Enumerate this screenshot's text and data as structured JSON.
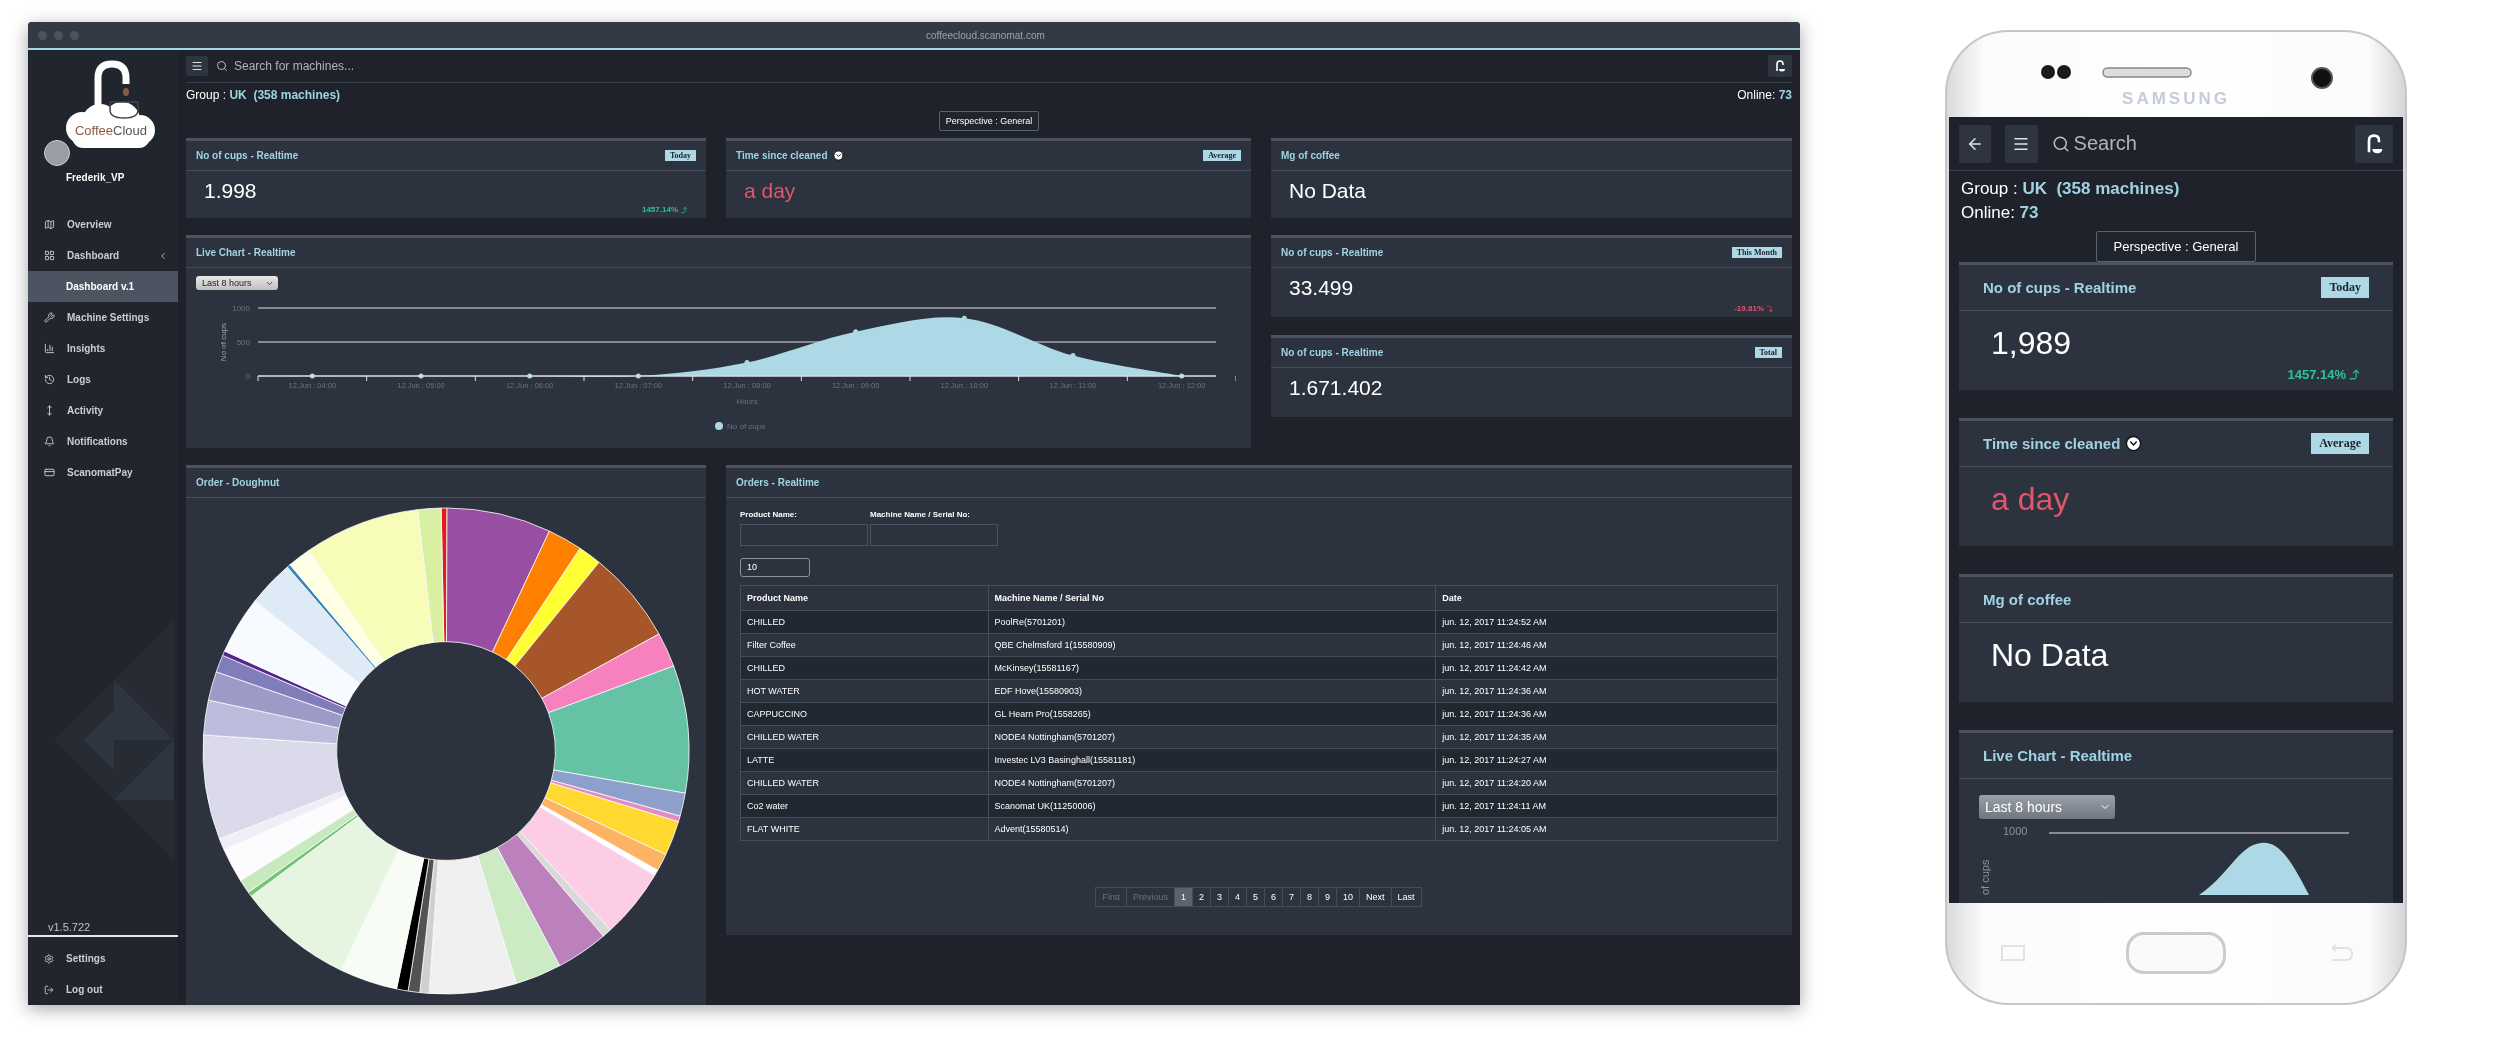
{
  "browser": {
    "url": "coffeecloud.scanomat.com"
  },
  "sidebar": {
    "logo": {
      "part_1": "Coffee",
      "part_2": "Cloud"
    },
    "user": "Frederik_VP",
    "nav": [
      {
        "label": "Overview",
        "selected": false
      },
      {
        "label": "Dashboard",
        "selected": false,
        "children": [
          {
            "label": "Dashboard v.1",
            "selected": true
          }
        ]
      },
      {
        "label": "Machine Settings",
        "selected": false
      },
      {
        "label": "Insights",
        "selected": false
      },
      {
        "label": "Logs",
        "selected": false
      },
      {
        "label": "Activity",
        "selected": false
      },
      {
        "label": "Notifications",
        "selected": false
      },
      {
        "label": "ScanomatPay",
        "selected": false
      }
    ],
    "version": "v1.5.722",
    "footer": [
      {
        "label": "Settings"
      },
      {
        "label": "Log out"
      }
    ]
  },
  "main": {
    "search": {
      "placeholder": "Search for machines..."
    },
    "group": {
      "label": "Group :",
      "name": "UK",
      "machines": "(358 machines)"
    },
    "online": {
      "label": "Online:",
      "value": "73"
    },
    "perspective": "Perspective : General",
    "stat_cards": [
      {
        "title": "No of cups - Realtime",
        "has_dropdown": false,
        "badge": "Today",
        "value": "1.998",
        "alert": false,
        "change": "1457.14%",
        "rising": true
      },
      {
        "title": "Time since cleaned",
        "has_dropdown": true,
        "badge": "Average",
        "value": "a day",
        "alert": true
      },
      {
        "title": "Mg of coffee",
        "has_dropdown": false,
        "value": "No Data",
        "alert": false
      }
    ],
    "live_chart": {
      "title": "Live Chart - Realtime",
      "range": "Last 8 hours",
      "chart_data": {
        "type": "area",
        "xlabel": "Hours",
        "ylabel": "No of cups",
        "categories": [
          "12.Jun : 04:00",
          "12.Jun : 05:00",
          "12.Jun : 06:00",
          "12.Jun : 07:00",
          "12.Jun : 08:00",
          "12.Jun : 09:00",
          "12.Jun : 10:00",
          "12.Jun : 11:00",
          "12.Jun : 12:00"
        ],
        "series": [
          {
            "name": "No of cups",
            "color": "#add8e6",
            "values": [
              0,
              0,
              0,
              0,
              200,
              650,
              850,
              300,
              0
            ]
          }
        ],
        "ylim": [
          0,
          1000
        ],
        "yticks": [
          0,
          500,
          1000
        ]
      }
    },
    "side_cards": [
      {
        "title": "No of cups - Realtime",
        "has_dropdown": false,
        "badge": "This Month",
        "value": "33.499",
        "alert": false,
        "change": "-19.81%",
        "rising": false
      },
      {
        "title": "No of cups - Realtime",
        "has_dropdown": false,
        "badge": "Total",
        "value": "1.671.402",
        "alert": false
      }
    ],
    "doughnut": {
      "title": "Order - Doughnut"
    },
    "orders": {
      "title": "Orders - Realtime",
      "filters": [
        {
          "label": "Product Name:"
        },
        {
          "label": "Machine Name / Serial No:"
        }
      ],
      "page_size": "10",
      "columns": [
        "Product Name",
        "Machine Name / Serial No",
        "Date"
      ],
      "rows": [
        [
          "CHILLED",
          "PoolRe(5701201)",
          "jun. 12, 2017 11:24:52 AM"
        ],
        [
          "Filter Coffee",
          "QBE Chelmsford 1(15580909)",
          "jun. 12, 2017 11:24:46 AM"
        ],
        [
          "CHILLED",
          "McKinsey(15581167)",
          "jun. 12, 2017 11:24:42 AM"
        ],
        [
          "HOT WATER",
          "EDF Hove(15580903)",
          "jun. 12, 2017 11:24:36 AM"
        ],
        [
          "CAPPUCCINO",
          "GL Hearn Pro(1558265)",
          "jun. 12, 2017 11:24:36 AM"
        ],
        [
          "CHILLED WATER",
          "NODE4 Nottingham(5701207)",
          "jun. 12, 2017 11:24:35 AM"
        ],
        [
          "LATTE",
          "Investec LV3 Basinghall(15581181)",
          "jun. 12, 2017 11:24:27 AM"
        ],
        [
          "CHILLED WATER",
          "NODE4 Nottingham(5701207)",
          "jun. 12, 2017 11:24:20 AM"
        ],
        [
          "Co2 water",
          "Scanomat UK(11250006)",
          "jun. 12, 2017 11:24:11 AM"
        ],
        [
          "FLAT WHITE",
          "Advent(15580514)",
          "jun. 12, 2017 11:24:05 AM"
        ]
      ],
      "pagination": [
        {
          "label": "First",
          "disabled": true,
          "selected": false
        },
        {
          "label": "Previous",
          "disabled": true,
          "selected": false
        },
        {
          "label": "1",
          "disabled": false,
          "selected": true
        },
        {
          "label": "2",
          "disabled": false,
          "selected": false
        },
        {
          "label": "3",
          "disabled": false,
          "selected": false
        },
        {
          "label": "4",
          "disabled": false,
          "selected": false
        },
        {
          "label": "5",
          "disabled": false,
          "selected": false
        },
        {
          "label": "6",
          "disabled": false,
          "selected": false
        },
        {
          "label": "7",
          "disabled": false,
          "selected": false
        },
        {
          "label": "8",
          "disabled": false,
          "selected": false
        },
        {
          "label": "9",
          "disabled": false,
          "selected": false
        },
        {
          "label": "10",
          "disabled": false,
          "selected": false
        },
        {
          "label": "Next",
          "disabled": false,
          "selected": false
        },
        {
          "label": "Last",
          "disabled": false,
          "selected": false
        }
      ]
    }
  },
  "phone": {
    "brand": "SAMSUNG",
    "search": {
      "placeholder": "Search"
    },
    "group": {
      "label": "Group :",
      "name": "UK",
      "machines": "(358 machines)"
    },
    "online": {
      "label": "Online:",
      "value": "73"
    },
    "perspective": "Perspective : General",
    "stat_cards": [
      {
        "title": "No of cups - Realtime",
        "has_dropdown": false,
        "badge": "Today",
        "value": "1,989",
        "alert": false,
        "change": "1457.14%",
        "rising": true
      },
      {
        "title": "Time since cleaned",
        "has_dropdown": true,
        "badge": "Average",
        "value": "a day",
        "alert": true
      },
      {
        "title": "Mg of coffee",
        "has_dropdown": false,
        "value": "No Data",
        "alert": false
      }
    ],
    "live_chart": {
      "title": "Live Chart - Realtime",
      "range": "Last 8 hours",
      "tick_label": "1000",
      "axis_label": "of cups"
    }
  }
}
